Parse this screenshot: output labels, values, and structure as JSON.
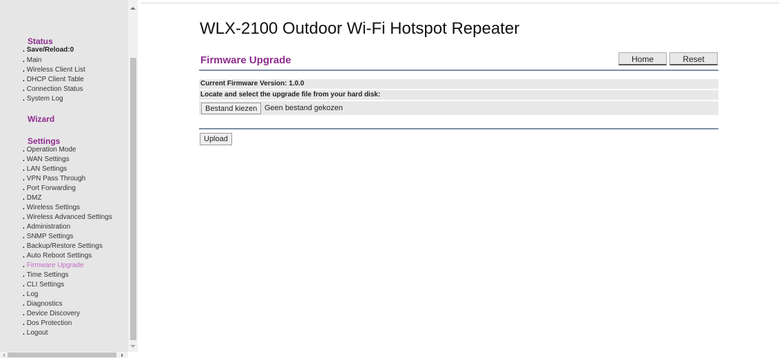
{
  "product_title": "WLX-2100 Outdoor Wi-Fi Hotspot Repeater",
  "page_heading": "Firmware Upgrade",
  "top_buttons": {
    "home": "Home",
    "reset": "Reset"
  },
  "sidebar": {
    "sections": [
      {
        "heading": "Status",
        "items": [
          "Save/Reload:0",
          "Main",
          "Wireless Client List",
          "DHCP Client Table",
          "Connection Status",
          "System Log"
        ]
      },
      {
        "heading": "Wizard",
        "items": []
      },
      {
        "heading": "Settings",
        "items": [
          "Operation Mode",
          "WAN Settings",
          "LAN Settings",
          "VPN Pass Through",
          "Port Forwarding",
          "DMZ",
          "Wireless Settings",
          "Wireless Advanced Settings",
          "Administration",
          "SNMP Settings",
          "Backup/Restore Settings",
          "Auto Reboot Settings",
          "Firmware Upgrade",
          "Time Settings",
          "CLI Settings",
          "Log",
          "Diagnostics",
          "Device Discovery",
          "Dos Protection",
          "Logout"
        ]
      }
    ],
    "active_item": "Firmware Upgrade"
  },
  "firmware": {
    "current_version_label": "Current Firmware Version: 1.0.0",
    "locate_label": "Locate and select the upgrade file from your hard disk:",
    "choose_file_label": "Bestand kiezen",
    "file_status": "Geen bestand gekozen",
    "upload_label": "Upload"
  },
  "colors": {
    "accent": "#8e2c8e",
    "active_link": "#c46ac4",
    "panel_bg": "#e6e6e6",
    "rule": "#7a8fa6"
  }
}
